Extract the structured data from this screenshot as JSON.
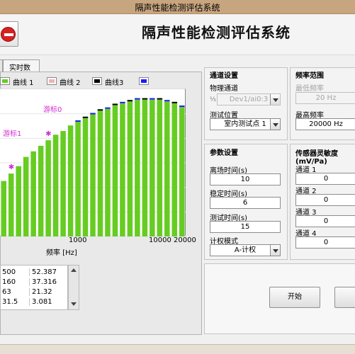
{
  "window": {
    "title": "隔声性能检测评估系统"
  },
  "header": {
    "app_title": "隔声性能检测评估系统"
  },
  "tabs": [
    {
      "label": ""
    },
    {
      "label": "实时数据"
    }
  ],
  "legend": [
    {
      "label": "曲线 1",
      "color": "#66cc22"
    },
    {
      "label": "曲线 2",
      "color": "#f0b3b3"
    },
    {
      "label": "曲线3",
      "color": "#000000"
    },
    {
      "label": "",
      "color": "#1a1aff"
    }
  ],
  "cursors": [
    {
      "label": "游标0"
    },
    {
      "label": "游标1"
    }
  ],
  "chart_data": {
    "type": "bar",
    "xlabel": "频率 [Hz]",
    "x_ticks": [
      "1000",
      "10000",
      "20000"
    ],
    "x_scale": "log",
    "series": [
      {
        "name": "曲线 1",
        "color": "#66cc22",
        "values": [
          30,
          34,
          38,
          43,
          46,
          49,
          52,
          55,
          57,
          60,
          62,
          64,
          66,
          68,
          69,
          71,
          72,
          73,
          74,
          74,
          74,
          74,
          73,
          72,
          70
        ]
      }
    ]
  },
  "table": {
    "rows": [
      [
        "500",
        "52.387"
      ],
      [
        "160",
        "37.316"
      ],
      [
        "63",
        "21.32"
      ],
      [
        "31.5",
        "3.081"
      ]
    ]
  },
  "channel": {
    "title": "通道设置",
    "physical_label": "物理通道",
    "physical_value": "Dev1/ai0:3",
    "position_label": "测试位置",
    "position_value": "室内测试点 1"
  },
  "freq": {
    "title": "频率范围",
    "min_label": "最低频率",
    "min_value": "20 Hz",
    "max_label": "最高频率",
    "max_value": "20000 Hz"
  },
  "params": {
    "title": "参数设置",
    "leave_label": "离场时间(s)",
    "leave_value": "10",
    "stable_label": "稳定时间(s)",
    "stable_value": "6",
    "test_label": "测试时间(s)",
    "test_value": "15",
    "weight_label": "计权模式",
    "weight_value": "A-计权"
  },
  "sensor": {
    "title": "传感器灵敏度(mV/Pa)",
    "ch1_label": "通道 1",
    "ch1_value": "0",
    "ch2_label": "通道 2",
    "ch2_value": "0",
    "ch3_label": "通道 3",
    "ch3_value": "0",
    "ch4_label": "通道 4",
    "ch4_value": "0"
  },
  "actions": {
    "start_label": "开始"
  }
}
